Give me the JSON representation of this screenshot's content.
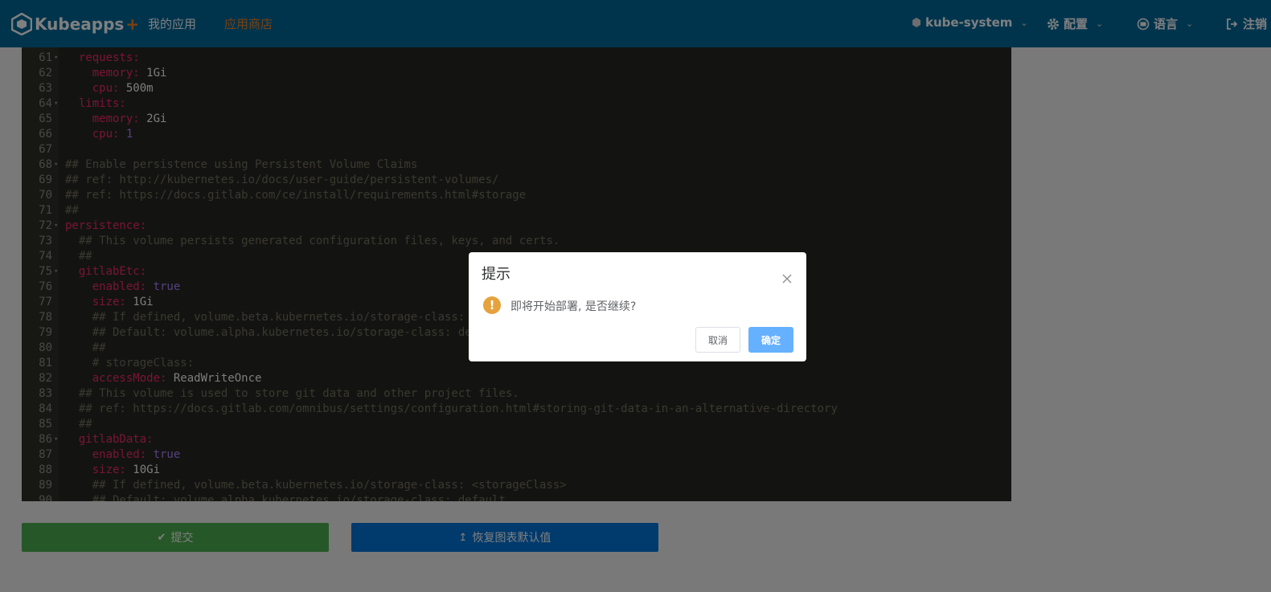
{
  "nav": {
    "logo_text": "Kubeapps",
    "logo_plus": "+",
    "links": [
      "我的应用",
      "应用商店"
    ],
    "namespace": "kube-system",
    "config": "配置",
    "language": "语言",
    "logout": "注销"
  },
  "editor": {
    "lines": [
      {
        "n": "61",
        "fold": true,
        "parts": [
          [
            "k",
            "  requests:"
          ]
        ]
      },
      {
        "n": "62",
        "fold": false,
        "parts": [
          [
            "k",
            "    memory: "
          ],
          [
            "v",
            "1Gi"
          ]
        ]
      },
      {
        "n": "63",
        "fold": false,
        "parts": [
          [
            "k",
            "    cpu: "
          ],
          [
            "v",
            "500m"
          ]
        ]
      },
      {
        "n": "64",
        "fold": true,
        "parts": [
          [
            "k",
            "  limits:"
          ]
        ]
      },
      {
        "n": "65",
        "fold": false,
        "parts": [
          [
            "k",
            "    memory: "
          ],
          [
            "v",
            "2Gi"
          ]
        ]
      },
      {
        "n": "66",
        "fold": false,
        "parts": [
          [
            "k",
            "    cpu: "
          ],
          [
            "b",
            "1"
          ]
        ]
      },
      {
        "n": "67",
        "fold": false,
        "parts": []
      },
      {
        "n": "68",
        "fold": true,
        "parts": [
          [
            "c",
            "## Enable persistence using Persistent Volume Claims"
          ]
        ]
      },
      {
        "n": "69",
        "fold": false,
        "parts": [
          [
            "c",
            "## ref: http://kubernetes.io/docs/user-guide/persistent-volumes/"
          ]
        ]
      },
      {
        "n": "70",
        "fold": false,
        "parts": [
          [
            "c",
            "## ref: https://docs.gitlab.com/ce/install/requirements.html#storage"
          ]
        ]
      },
      {
        "n": "71",
        "fold": false,
        "parts": [
          [
            "c",
            "##"
          ]
        ]
      },
      {
        "n": "72",
        "fold": true,
        "parts": [
          [
            "k",
            "persistence:"
          ]
        ]
      },
      {
        "n": "73",
        "fold": false,
        "parts": [
          [
            "c",
            "  ## This volume persists generated configuration files, keys, and certs."
          ]
        ]
      },
      {
        "n": "74",
        "fold": false,
        "parts": [
          [
            "c",
            "  ##"
          ]
        ]
      },
      {
        "n": "75",
        "fold": true,
        "parts": [
          [
            "k",
            "  gitlabEtc:"
          ]
        ]
      },
      {
        "n": "76",
        "fold": false,
        "parts": [
          [
            "k",
            "    enabled: "
          ],
          [
            "b",
            "true"
          ]
        ]
      },
      {
        "n": "77",
        "fold": false,
        "parts": [
          [
            "k",
            "    size: "
          ],
          [
            "v",
            "1Gi"
          ]
        ]
      },
      {
        "n": "78",
        "fold": false,
        "parts": [
          [
            "c",
            "    ## If defined, volume.beta.kubernetes.io/storage-class: <storageClass>"
          ]
        ]
      },
      {
        "n": "79",
        "fold": false,
        "parts": [
          [
            "c",
            "    ## Default: volume.alpha.kubernetes.io/storage-class: default"
          ]
        ]
      },
      {
        "n": "80",
        "fold": false,
        "parts": [
          [
            "c",
            "    ##"
          ]
        ]
      },
      {
        "n": "81",
        "fold": false,
        "parts": [
          [
            "c",
            "    # storageClass:"
          ]
        ]
      },
      {
        "n": "82",
        "fold": false,
        "parts": [
          [
            "k",
            "    accessMode: "
          ],
          [
            "v",
            "ReadWriteOnce"
          ]
        ]
      },
      {
        "n": "83",
        "fold": false,
        "parts": [
          [
            "c",
            "  ## This volume is used to store git data and other project files."
          ]
        ]
      },
      {
        "n": "84",
        "fold": false,
        "parts": [
          [
            "c",
            "  ## ref: https://docs.gitlab.com/omnibus/settings/configuration.html#storing-git-data-in-an-alternative-directory"
          ]
        ]
      },
      {
        "n": "85",
        "fold": false,
        "parts": [
          [
            "c",
            "  ##"
          ]
        ]
      },
      {
        "n": "86",
        "fold": true,
        "parts": [
          [
            "k",
            "  gitlabData:"
          ]
        ]
      },
      {
        "n": "87",
        "fold": false,
        "parts": [
          [
            "k",
            "    enabled: "
          ],
          [
            "b",
            "true"
          ]
        ]
      },
      {
        "n": "88",
        "fold": false,
        "parts": [
          [
            "k",
            "    size: "
          ],
          [
            "v",
            "10Gi"
          ]
        ]
      },
      {
        "n": "89",
        "fold": false,
        "parts": [
          [
            "c",
            "    ## If defined, volume.beta.kubernetes.io/storage-class: <storageClass>"
          ]
        ]
      },
      {
        "n": "90",
        "fold": false,
        "parts": [
          [
            "c",
            "    ## Default: volume.alpha.kubernetes.io/storage-class: default"
          ]
        ]
      }
    ]
  },
  "actions": {
    "submit": "提交",
    "restore": "恢复图表默认值"
  },
  "dialog": {
    "title": "提示",
    "message": "即将开始部署, 是否继续?",
    "cancel": "取消",
    "confirm": "确定"
  },
  "colors": {
    "nav_bg": "#01689a",
    "nav_active": "#f58220",
    "submit_bg": "#4caf50",
    "restore_bg": "#0275d8",
    "confirm_bg": "#66b1ff",
    "warning": "#e6a23c"
  }
}
